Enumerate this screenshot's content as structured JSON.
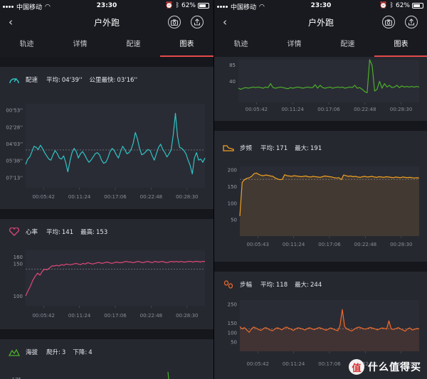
{
  "status": {
    "carrier": "中国移动",
    "time": "23:30",
    "battery": "62%"
  },
  "header": {
    "title": "户外跑",
    "back_label": "‹",
    "camera_icon": "camera-icon",
    "share_icon": "share-icon"
  },
  "tabs": [
    {
      "label": "轨迹",
      "active": false
    },
    {
      "label": "详情",
      "active": false
    },
    {
      "label": "配速",
      "active": false
    },
    {
      "label": "图表",
      "active": true
    }
  ],
  "cards": {
    "pace": {
      "title": "配速",
      "stat1_label": "平均:",
      "stat1_value": "04'39''",
      "stat2_label": "公里最快:",
      "stat2_value": "03'16''",
      "color": "#2ec4c4",
      "icon": "pace-gauge-icon"
    },
    "heart": {
      "title": "心率",
      "stat1_label": "平均:",
      "stat1_value": "141",
      "stat2_label": "最高:",
      "stat2_value": "153",
      "color": "#e0487a",
      "icon": "heart-icon"
    },
    "altitude": {
      "title": "海拔",
      "stat1_label": "爬升:",
      "stat1_value": "3",
      "stat2_label": "下降:",
      "stat2_value": "4",
      "color": "#4caf2a",
      "icon": "mountain-icon"
    },
    "cadence": {
      "title": "步频",
      "stat1_label": "平均:",
      "stat1_value": "171",
      "stat2_label": "最大:",
      "stat2_value": "191",
      "color": "#f0a020",
      "icon": "shoe-icon"
    },
    "stride": {
      "title": "步幅",
      "stat1_label": "平均:",
      "stat1_value": "118",
      "stat2_label": "最大:",
      "stat2_value": "244",
      "color": "#f26a2a",
      "icon": "footprints-icon"
    }
  },
  "watermark": {
    "badge": "值",
    "text": "什么值得买"
  },
  "chart_data": [
    {
      "id": "pace",
      "type": "line",
      "y_ticks": [
        "00'53''",
        "02'28''",
        "04'03''",
        "05'38''",
        "07'13''"
      ],
      "y_tick_values": [
        0.88,
        2.47,
        4.05,
        5.63,
        7.22
      ],
      "ylim": [
        0.3,
        8.2
      ],
      "y_inverted": true,
      "avg": 4.65,
      "x_ticks": [
        "00:05:42",
        "00:11:24",
        "00:17:06",
        "00:22:48",
        "00:28:30"
      ],
      "values": [
        6.0,
        5.5,
        5.3,
        4.8,
        4.3,
        4.4,
        4.6,
        4.2,
        4.5,
        4.9,
        5.2,
        5.5,
        5.6,
        5.1,
        4.7,
        5.0,
        5.4,
        5.5,
        5.2,
        5.8,
        6.7,
        5.7,
        4.9,
        4.5,
        4.8,
        5.4,
        5.0,
        4.8,
        5.1,
        5.5,
        5.8,
        5.6,
        5.3,
        5.0,
        4.9,
        5.1,
        5.6,
        5.9,
        5.8,
        5.4,
        4.8,
        4.5,
        4.7,
        5.1,
        5.4,
        4.8,
        4.3,
        4.6,
        5.0,
        4.9,
        4.6,
        4.0,
        3.0,
        3.6,
        4.5,
        5.1,
        5.0,
        4.8,
        4.6,
        4.7,
        5.2,
        5.6,
        5.0,
        4.4,
        4.1,
        4.6,
        4.9,
        5.3,
        5.0,
        4.6,
        3.2,
        1.2,
        3.4,
        4.4,
        4.5,
        4.7,
        5.0,
        5.6,
        6.1,
        6.9,
        5.4,
        4.9,
        5.6,
        5.5,
        5.8,
        5.4
      ]
    },
    {
      "id": "heart",
      "type": "line",
      "y_ticks": [
        "160",
        "150",
        "100"
      ],
      "y_tick_values": [
        160,
        150,
        100
      ],
      "ylim": [
        85,
        170
      ],
      "avg": 141,
      "x_ticks": [
        "00:05:42",
        "00:11:24",
        "00:17:06",
        "00:22:48",
        "00:28:30"
      ],
      "values": [
        100,
        108,
        115,
        124,
        130,
        135,
        132,
        138,
        141,
        140,
        143,
        146,
        146,
        147,
        146,
        148,
        147,
        149,
        148,
        148,
        149,
        150,
        149,
        148,
        150,
        149,
        151,
        150,
        149,
        150,
        151,
        151,
        150,
        151,
        152,
        151,
        150,
        151,
        152,
        151,
        151,
        152,
        153,
        152,
        152,
        151,
        152,
        153,
        152,
        151,
        152,
        153,
        152,
        151,
        153,
        152,
        152,
        153,
        152,
        151,
        152,
        153,
        152,
        153,
        152,
        153,
        152,
        152,
        153,
        153,
        152,
        153,
        153,
        152,
        153,
        153
      ]
    },
    {
      "id": "altitude",
      "type": "line",
      "y_ticks": [
        "175",
        "85",
        "40"
      ],
      "y_tick_values": [
        175,
        85,
        40
      ],
      "x_ticks": [
        "00:05:42",
        "00:11:24",
        "00:17:06",
        "00:22:48",
        "00:28:30"
      ],
      "values": [
        50,
        48,
        50,
        51,
        50,
        51,
        52,
        51,
        52,
        51,
        50,
        52,
        51,
        58,
        51,
        50,
        51,
        52,
        51,
        50,
        49,
        51,
        50,
        51,
        52,
        51,
        50,
        51,
        52,
        51,
        51,
        56,
        50,
        55,
        51,
        50,
        51,
        52,
        50,
        51,
        52,
        51,
        52,
        50,
        51,
        52,
        51,
        55,
        50,
        51,
        48,
        44,
        42,
        100,
        90,
        45,
        48,
        62,
        50,
        58,
        52,
        55,
        51,
        52,
        55,
        51,
        54,
        52,
        53,
        52,
        53,
        52,
        53,
        52
      ]
    },
    {
      "id": "cadence",
      "type": "area",
      "y_ticks": [
        "200",
        "150",
        "100",
        "50"
      ],
      "y_tick_values": [
        200,
        150,
        100,
        50
      ],
      "ylim": [
        0,
        210
      ],
      "avg": 171,
      "x_ticks": [
        "00:05:43",
        "00:11:24",
        "00:17:06",
        "00:22:48",
        "00:28:30"
      ],
      "values": [
        60,
        162,
        170,
        174,
        176,
        180,
        188,
        190,
        186,
        183,
        182,
        184,
        183,
        181,
        180,
        175,
        172,
        170,
        171,
        185,
        182,
        181,
        180,
        182,
        181,
        180,
        179,
        180,
        181,
        179,
        178,
        180,
        179,
        178,
        177,
        179,
        181,
        180,
        179,
        178,
        176,
        175,
        176,
        170,
        184,
        182,
        180,
        181,
        179,
        180,
        178,
        177,
        179,
        180,
        178,
        179,
        180,
        178,
        177,
        179,
        178,
        177,
        179,
        178,
        177,
        176,
        178,
        177,
        176,
        178,
        177,
        176,
        177,
        176,
        175,
        176,
        175
      ]
    },
    {
      "id": "stride",
      "type": "area",
      "y_ticks": [
        "250",
        "150",
        "100",
        "50"
      ],
      "y_tick_values": [
        250,
        150,
        100,
        50
      ],
      "ylim": [
        0,
        270
      ],
      "avg": 118,
      "x_ticks": [
        "00:05:42",
        "00:11:24",
        "00:17:06",
        "00:22:48",
        "00:28:30"
      ],
      "values": [
        130,
        118,
        125,
        112,
        100,
        118,
        128,
        122,
        115,
        110,
        118,
        125,
        120,
        112,
        108,
        117,
        124,
        120,
        113,
        122,
        128,
        121,
        117,
        110,
        118,
        124,
        121,
        117,
        112,
        120,
        124,
        118,
        114,
        120,
        125,
        121,
        116,
        111,
        117,
        123,
        118,
        113,
        108,
        135,
        220,
        130,
        118,
        112,
        107,
        115,
        123,
        128,
        124,
        119,
        117,
        121,
        126,
        122,
        118,
        113,
        118,
        123,
        121,
        117,
        160,
        118,
        115,
        120,
        125,
        118,
        112,
        106,
        118,
        123,
        112,
        116,
        120,
        118
      ]
    }
  ]
}
